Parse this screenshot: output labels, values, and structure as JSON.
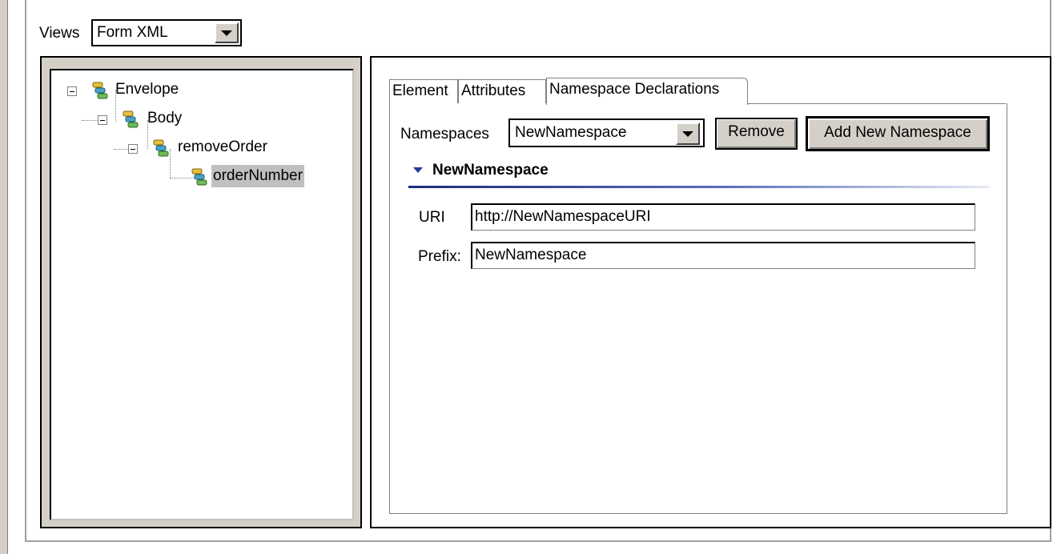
{
  "views": {
    "label": "Views",
    "selected": "Form XML"
  },
  "tree": {
    "nodes": [
      {
        "label": "Envelope",
        "expanded": true,
        "level": 0
      },
      {
        "label": "Body",
        "expanded": true,
        "level": 1
      },
      {
        "label": "removeOrder",
        "expanded": true,
        "level": 2
      },
      {
        "label": "orderNumber",
        "selected": true,
        "level": 3
      }
    ]
  },
  "tabs": [
    {
      "label": "Element"
    },
    {
      "label": "Attributes"
    },
    {
      "label": "Namespace Declarations",
      "active": true
    }
  ],
  "namespaces": {
    "label": "Namespaces",
    "selected": "NewNamespace",
    "remove_label": "Remove",
    "add_label": "Add New Namespace"
  },
  "section": {
    "title": "NewNamespace",
    "uri_label": "URI",
    "uri_value": "http://NewNamespaceURI",
    "prefix_label": "Prefix:",
    "prefix_value": "NewNamespace"
  },
  "colors": {
    "section_line_start": "#1a2e7a",
    "section_line_end": "#e6e9f5",
    "selection_bg": "#c0c0c0",
    "chrome_bg": "#d4d0c8"
  }
}
